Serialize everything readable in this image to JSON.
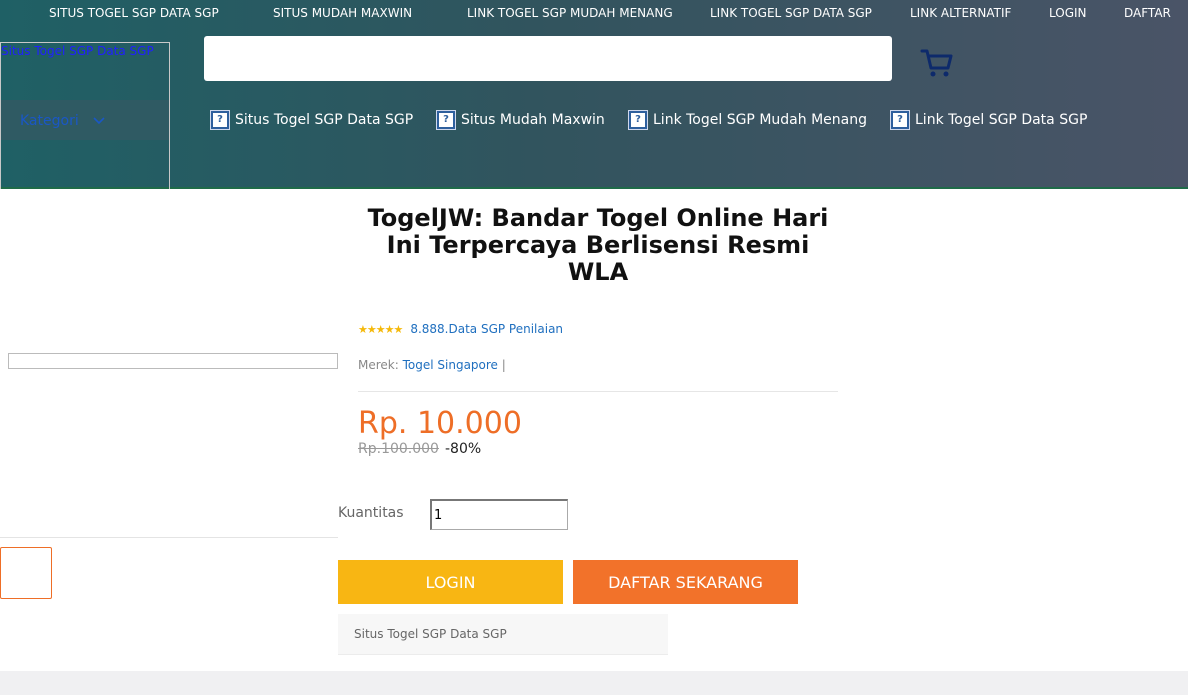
{
  "top_nav": [
    {
      "label": "SITUS TOGEL SGP DATA SGP"
    },
    {
      "label": "SITUS MUDAH MAXWIN"
    },
    {
      "label": "LINK TOGEL SGP MUDAH MENANG"
    },
    {
      "label": "LINK TOGEL SGP DATA SGP"
    },
    {
      "label": "LINK ALTERNATIF"
    },
    {
      "label": "LOGIN"
    },
    {
      "label": "DAFTAR"
    }
  ],
  "logo_link": "Situs Togel SGP Data SGP",
  "kategori": {
    "label": "Kategori",
    "icon": "chevron-down-icon"
  },
  "search": {
    "value": "",
    "placeholder": ""
  },
  "cart_icon": "shopping-cart-icon",
  "category_nav": [
    {
      "label": "Situs Togel SGP Data SGP",
      "icon": "broken-image-icon"
    },
    {
      "label": "Situs Mudah Maxwin",
      "icon": "broken-image-icon"
    },
    {
      "label": "Link Togel SGP Mudah Menang",
      "icon": "broken-image-icon"
    },
    {
      "label": "Link Togel SGP Data SGP",
      "icon": "broken-image-icon"
    }
  ],
  "product": {
    "title": "TogelJW: Bandar Togel Online Hari Ini Terpercaya Berlisensi Resmi WLA",
    "rating_stars": 5,
    "rating_text": "8.888.Data SGP Penilaian",
    "brand_label": "Merek:",
    "brand_value": "Togel Singapore",
    "brand_separator": "|",
    "price": "Rp. 10.000",
    "old_price": "Rp.100.000",
    "discount": "-80%",
    "quantity_label": "Kuantitas",
    "quantity_value": "1",
    "login_button": "LOGIN",
    "daftar_button": "DAFTAR SEKARANG",
    "tag": "Situs Togel SGP Data SGP"
  },
  "colors": {
    "accent_orange": "#ee6e27",
    "login_yellow": "#f8b613",
    "daftar_orange": "#f2722a",
    "link_blue": "#1f6fbf",
    "star_gold": "#f5b90a"
  }
}
